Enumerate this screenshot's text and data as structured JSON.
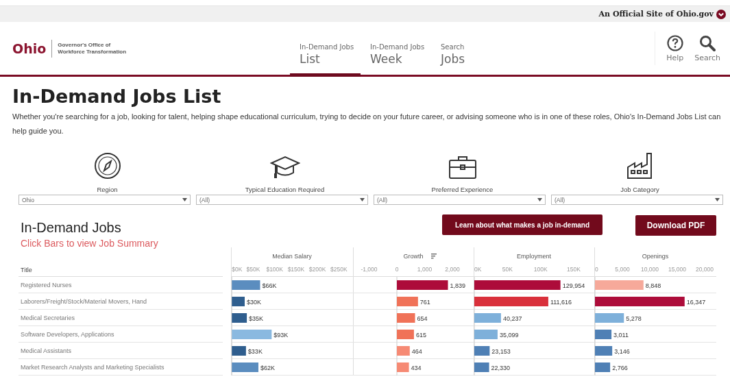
{
  "official_bar": {
    "text": "An Official Site of",
    "site_link": "Ohio.gov"
  },
  "header": {
    "logo": {
      "name": "Ohio",
      "agency_lines": [
        "Governor's Office of",
        "Workforce Transformation"
      ]
    },
    "nav_tabs": [
      {
        "top": "In-Demand Jobs",
        "bottom": "List",
        "selected": true
      },
      {
        "top": "In-Demand Jobs",
        "bottom": "Week",
        "selected": false
      },
      {
        "top": "Search",
        "bottom": "Jobs",
        "selected": false
      }
    ],
    "tools": [
      {
        "kind": "help",
        "label": "Help"
      },
      {
        "kind": "search",
        "label": "Search"
      }
    ]
  },
  "page": {
    "title": "In-Demand Jobs List",
    "intro": "Whether you're searching for a job, looking for talent, helping shape educational curriculum, trying to decide on your future career, or advising someone who is in one of these roles, Ohio's In-Demand Jobs List can help guide you."
  },
  "filters": [
    {
      "kind": "region",
      "label": "Region",
      "value": "Ohio"
    },
    {
      "kind": "education",
      "label": "Typical Education Required",
      "value": "(All)"
    },
    {
      "kind": "experience",
      "label": "Preferred Experience",
      "value": "(All)"
    },
    {
      "kind": "category",
      "label": "Job Category",
      "value": "(All)"
    }
  ],
  "section": {
    "title": "In-Demand Jobs",
    "subtitle": "Click Bars to view Job Summary",
    "buttons": [
      "Learn about what makes a job in-demand",
      "Download PDF"
    ]
  },
  "table": {
    "title_header": "Title",
    "rows": [
      "Registered Nurses",
      "Laborers/Freight/Stock/Material Movers, Hand",
      "Medical Secretaries",
      "Software Developers, Applications",
      "Medical Assistants",
      "Market Research Analysts and Marketing Specialists"
    ],
    "metrics": [
      {
        "sorted": false,
        "chart_data": {
          "type": "bar",
          "orientation": "horizontal",
          "title": "Median Salary",
          "stacked": true,
          "series": [
            {
              "color": "#5b8dbf",
              "values": [
                66,
                null,
                null,
                null,
                null,
                62
              ]
            },
            {
              "color": "#2f5e8e",
              "values": [
                null,
                30,
                35,
                null,
                33,
                null
              ]
            },
            {
              "color": "#8ab9e0",
              "values": [
                null,
                null,
                null,
                93,
                null,
                null
              ]
            }
          ],
          "value_labels": [
            "$66K",
            "$30K",
            "$35K",
            "$93K",
            "$33K",
            "$62K"
          ],
          "xlim": [
            -2,
            283
          ],
          "xticks": [
            {
              "value": 0,
              "label": "$0K"
            },
            {
              "value": 50,
              "label": "$50K"
            },
            {
              "value": 100,
              "label": "$100K"
            },
            {
              "value": 150,
              "label": "$150K"
            },
            {
              "value": 200,
              "label": "$200K"
            },
            {
              "value": 250,
              "label": "$250K"
            }
          ]
        }
      },
      {
        "sorted": true,
        "chart_data": {
          "type": "bar",
          "orientation": "horizontal",
          "title": "Growth",
          "stacked": true,
          "series": [
            {
              "color": "#ad0c3a",
              "values": [
                1839,
                null,
                null,
                null,
                null,
                null
              ]
            },
            {
              "color": "#f07258",
              "values": [
                null,
                761,
                654,
                615,
                null,
                null
              ]
            },
            {
              "color": "#f68a74",
              "values": [
                null,
                null,
                null,
                null,
                464,
                434
              ]
            }
          ],
          "value_labels": [
            "1,839",
            "761",
            "654",
            "615",
            "464",
            "434"
          ],
          "xlim": [
            -1580,
            2765
          ],
          "xticks": [
            {
              "value": -1000,
              "label": "-1,000"
            },
            {
              "value": 0,
              "label": "0"
            },
            {
              "value": 1000,
              "label": "1,000"
            },
            {
              "value": 2000,
              "label": "2,000"
            }
          ]
        }
      },
      {
        "sorted": false,
        "chart_data": {
          "type": "bar",
          "orientation": "horizontal",
          "title": "Employment",
          "stacked": true,
          "series": [
            {
              "color": "#ad0c3a",
              "values": [
                129954,
                null,
                null,
                null,
                null,
                null
              ]
            },
            {
              "color": "#d9303b",
              "values": [
                null,
                111616,
                null,
                null,
                null,
                null
              ]
            },
            {
              "color": "#7eb0da",
              "values": [
                null,
                null,
                40237,
                35099,
                null,
                null
              ]
            },
            {
              "color": "#4f80b5",
              "values": [
                null,
                null,
                null,
                null,
                23153,
                22330
              ]
            }
          ],
          "value_labels": [
            "129,954",
            "111,616",
            "40,237",
            "35,099",
            "23,153",
            "22,330"
          ],
          "xlim": [
            -1000,
            181000
          ],
          "xticks": [
            {
              "value": 0,
              "label": "0K"
            },
            {
              "value": 50000,
              "label": "50K"
            },
            {
              "value": 100000,
              "label": "100K"
            },
            {
              "value": 150000,
              "label": "150K"
            }
          ]
        }
      },
      {
        "sorted": false,
        "chart_data": {
          "type": "bar",
          "orientation": "horizontal",
          "title": "Openings",
          "stacked": true,
          "series": [
            {
              "color": "#f6a99a",
              "values": [
                8848,
                null,
                null,
                null,
                null,
                null
              ]
            },
            {
              "color": "#ad0c3a",
              "values": [
                null,
                16347,
                null,
                null,
                null,
                null
              ]
            },
            {
              "color": "#7eb0da",
              "values": [
                null,
                null,
                5278,
                null,
                null,
                null
              ]
            },
            {
              "color": "#4f80b5",
              "values": [
                null,
                null,
                null,
                3011,
                3146,
                2766
              ]
            }
          ],
          "value_labels": [
            "8,848",
            "16,347",
            "5,278",
            "3,011",
            "3,146",
            "2,766"
          ],
          "xlim": [
            -125,
            22125
          ],
          "xticks": [
            {
              "value": 0,
              "label": "0"
            },
            {
              "value": 5000,
              "label": "5,000"
            },
            {
              "value": 10000,
              "label": "10,000"
            },
            {
              "value": 15000,
              "label": "15,000"
            },
            {
              "value": 20000,
              "label": "20,000"
            }
          ]
        }
      }
    ]
  }
}
